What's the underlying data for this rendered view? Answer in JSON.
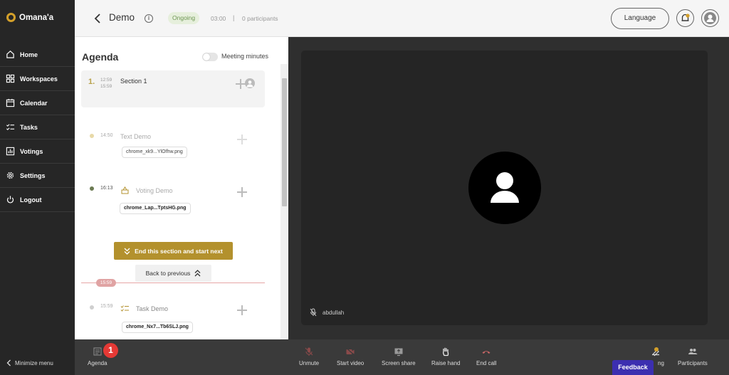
{
  "app": {
    "logo_text": "Omana'a"
  },
  "sidebar": {
    "items": [
      {
        "label": "Home",
        "icon": "home-icon"
      },
      {
        "label": "Workspaces",
        "icon": "workspaces-icon"
      },
      {
        "label": "Calendar",
        "icon": "calendar-icon"
      },
      {
        "label": "Tasks",
        "icon": "tasks-icon"
      },
      {
        "label": "Votings",
        "icon": "votings-icon"
      },
      {
        "label": "Settings",
        "icon": "gear-icon"
      },
      {
        "label": "Logout",
        "icon": "power-icon"
      }
    ],
    "minimize_label": "Minimize menu"
  },
  "header": {
    "title": "Demo",
    "status": "Ongoing",
    "timer": "03:00",
    "separator": "|",
    "participants": "0 participants",
    "language_button": "Language"
  },
  "agenda": {
    "title": "Agenda",
    "minutes_label": "Meeting minutes",
    "section": {
      "number": "1.",
      "start": "12:59",
      "end": "15:59",
      "title": "Section 1"
    },
    "items": [
      {
        "time": "14:50",
        "title": "Text Demo",
        "file": "chrome_xk9...YlOfhw.png",
        "dot_color": "#e8d9a8"
      },
      {
        "time": "16:13",
        "title": "Voting Demo",
        "file": "chrome_Lap...TptsHG.png",
        "dot_color": "#6b7a52"
      },
      {
        "time": "15:59",
        "title": "Task Demo",
        "file": "chrome_Nx7...Tb6SLJ.png",
        "dot_color": "#cfcfcf"
      }
    ],
    "end_button": "End this section and start next",
    "back_button": "Back to previous",
    "current_time": "15:59"
  },
  "video": {
    "participant_name": "abdullah"
  },
  "controls": {
    "agenda_label": "Agenda",
    "agenda_badge": "1",
    "unmute": "Unmute",
    "start_video": "Start video",
    "screen_share": "Screen share",
    "raise_hand": "Raise hand",
    "end_call": "End call",
    "recording_partial": "ng",
    "participants": "Participants",
    "feedback": "Feedback"
  },
  "colors": {
    "accent": "#b3912d",
    "sidebar": "#262626",
    "status_green": "#6e9653",
    "feedback": "#3c2fb0",
    "badge_red": "#e53935"
  }
}
